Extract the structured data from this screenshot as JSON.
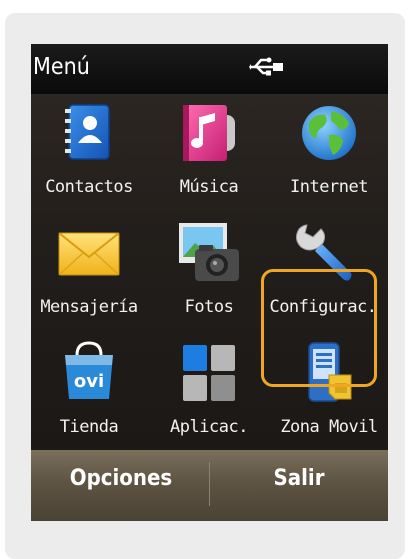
{
  "status_bar": {
    "title": "Menú",
    "usb_icon": "usb-connected-icon"
  },
  "menu": {
    "items": [
      {
        "label": "Contactos",
        "icon": "contacts-icon"
      },
      {
        "label": "Música",
        "icon": "music-icon"
      },
      {
        "label": "Internet",
        "icon": "globe-icon"
      },
      {
        "label": "Mensajería",
        "icon": "envelope-icon"
      },
      {
        "label": "Fotos",
        "icon": "camera-photo-icon"
      },
      {
        "label": "Configurac.",
        "icon": "wrench-icon",
        "selected": true
      },
      {
        "label": "Tienda",
        "icon": "ovi-store-bag-icon"
      },
      {
        "label": "Aplicac.",
        "icon": "apps-grid-icon"
      },
      {
        "label": "Zona Movil",
        "icon": "phone-sim-icon"
      }
    ],
    "highlight_color": "#f0a623"
  },
  "softkeys": {
    "left": "Opciones",
    "right": "Salir"
  }
}
